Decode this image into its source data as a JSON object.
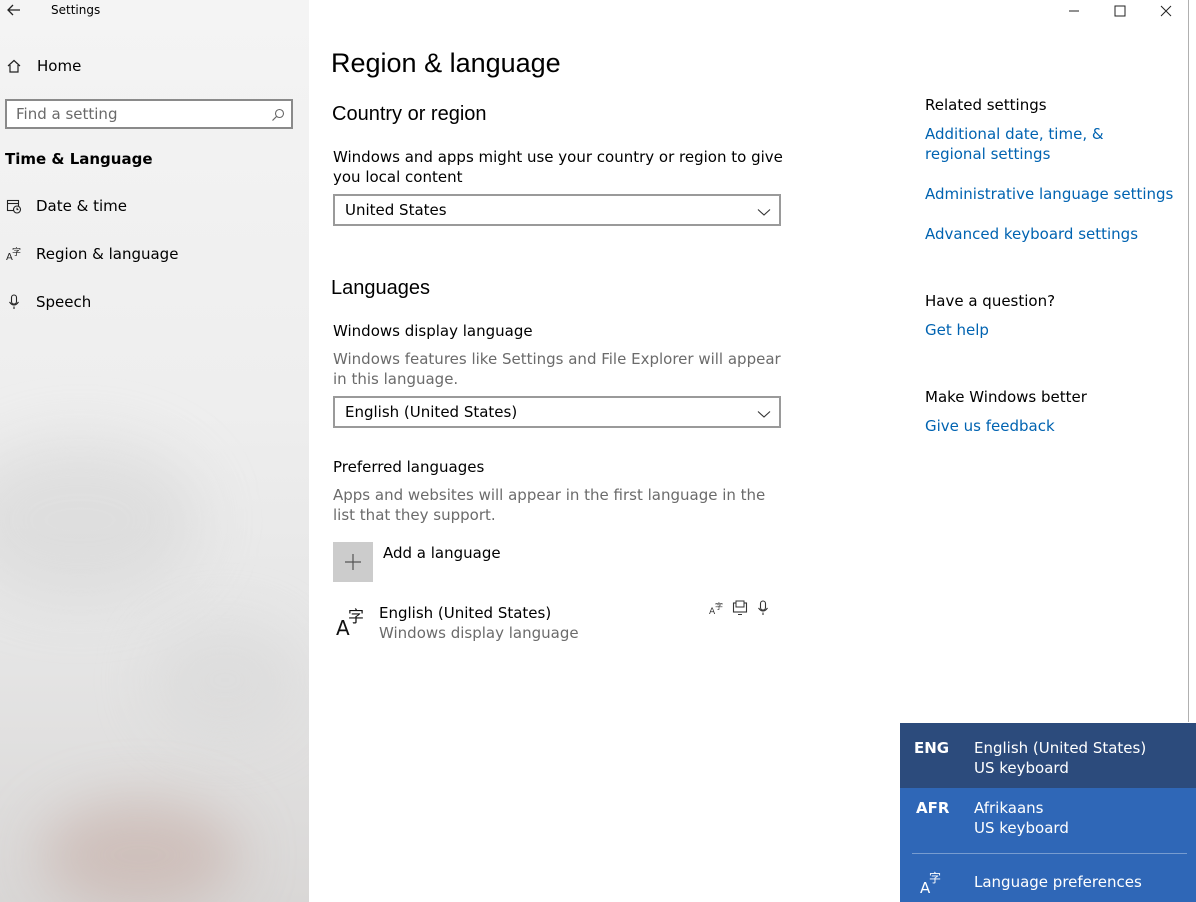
{
  "window": {
    "app_title": "Settings",
    "minimize_icon": "minimize-icon",
    "maximize_icon": "maximize-icon",
    "close_icon": "close-icon"
  },
  "sidebar": {
    "home_label": "Home",
    "search_placeholder": "Find a setting",
    "section_title": "Time & Language",
    "items": [
      {
        "label": "Date & time",
        "icon": "calendar-clock-icon"
      },
      {
        "label": "Region & language",
        "icon": "language-icon"
      },
      {
        "label": "Speech",
        "icon": "microphone-icon"
      }
    ]
  },
  "main": {
    "title": "Region & language",
    "country": {
      "heading": "Country or region",
      "description": "Windows and apps might use your country or region to give you local content",
      "selected": "United States"
    },
    "languages": {
      "heading": "Languages",
      "display_language_label": "Windows display language",
      "display_language_desc": "Windows features like Settings and File Explorer will appear in this language.",
      "display_language_selected": "English (United States)",
      "preferred_label": "Preferred languages",
      "preferred_desc": "Apps and websites will appear in the first language in the list that they support.",
      "add_language": "Add a language",
      "list": [
        {
          "name": "English (United States)",
          "sub": "Windows display language"
        }
      ]
    }
  },
  "related": {
    "heading": "Related settings",
    "links": [
      "Additional date, time, & regional settings",
      "Administrative language settings",
      "Advanced keyboard settings"
    ],
    "question_heading": "Have a question?",
    "help_link": "Get help",
    "better_heading": "Make Windows better",
    "feedback_link": "Give us feedback"
  },
  "flyout": {
    "items": [
      {
        "code": "ENG",
        "name": "English (United States)",
        "keyboard": "US keyboard"
      },
      {
        "code": "AFR",
        "name": "Afrikaans",
        "keyboard": "US keyboard"
      }
    ],
    "preferences": "Language preferences"
  },
  "colors": {
    "accent_link": "#0063b1",
    "flyout_bg": "#2f67b7",
    "flyout_selected": "#2c4b7c"
  }
}
